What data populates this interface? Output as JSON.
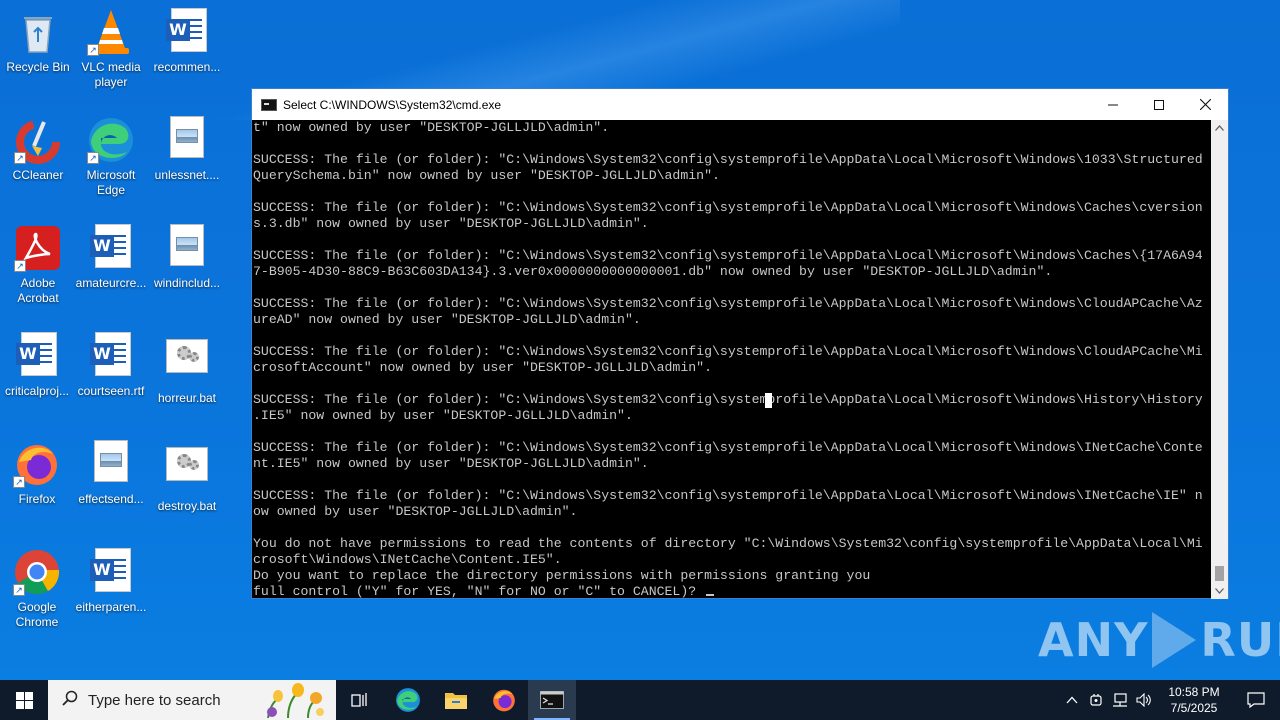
{
  "desktop": {
    "icons": [
      {
        "label": "Recycle Bin",
        "icon": "recycle-bin-icon"
      },
      {
        "label": "VLC media player",
        "icon": "vlc-icon"
      },
      {
        "label": "recommen...",
        "icon": "word-document-icon"
      },
      {
        "label": "CCleaner",
        "icon": "ccleaner-icon"
      },
      {
        "label": "Microsoft Edge",
        "icon": "edge-icon"
      },
      {
        "label": "unlessnet....",
        "icon": "image-file-icon"
      },
      {
        "label": "Adobe Acrobat",
        "icon": "acrobat-icon"
      },
      {
        "label": "amateurcre...",
        "icon": "word-document-icon"
      },
      {
        "label": "windinclud...",
        "icon": "image-file-icon"
      },
      {
        "label": "criticalproj...",
        "icon": "word-document-icon"
      },
      {
        "label": "courtseen.rtf",
        "icon": "word-document-icon"
      },
      {
        "label": "horreur.bat",
        "icon": "batch-file-icon"
      },
      {
        "label": "Firefox",
        "icon": "firefox-icon"
      },
      {
        "label": "effectsend...",
        "icon": "image-file-icon"
      },
      {
        "label": "destroy.bat",
        "icon": "batch-file-icon"
      },
      {
        "label": "Google Chrome",
        "icon": "chrome-icon"
      },
      {
        "label": "eitherparen...",
        "icon": "word-document-icon"
      }
    ]
  },
  "cmd": {
    "title": "Select C:\\WINDOWS\\System32\\cmd.exe",
    "lines": [
      "t\" now owned by user \"DESKTOP-JGLLJLD\\admin\".",
      "",
      "SUCCESS: The file (or folder): \"C:\\Windows\\System32\\config\\systemprofile\\AppData\\Local\\Microsoft\\Windows\\1033\\Structured",
      "QuerySchema.bin\" now owned by user \"DESKTOP-JGLLJLD\\admin\".",
      "",
      "SUCCESS: The file (or folder): \"C:\\Windows\\System32\\config\\systemprofile\\AppData\\Local\\Microsoft\\Windows\\Caches\\cversion",
      "s.3.db\" now owned by user \"DESKTOP-JGLLJLD\\admin\".",
      "",
      "SUCCESS: The file (or folder): \"C:\\Windows\\System32\\config\\systemprofile\\AppData\\Local\\Microsoft\\Windows\\Caches\\{17A6A94",
      "7-B905-4D30-88C9-B63C603DA134}.3.ver0x0000000000000001.db\" now owned by user \"DESKTOP-JGLLJLD\\admin\".",
      "",
      "SUCCESS: The file (or folder): \"C:\\Windows\\System32\\config\\systemprofile\\AppData\\Local\\Microsoft\\Windows\\CloudAPCache\\Az",
      "ureAD\" now owned by user \"DESKTOP-JGLLJLD\\admin\".",
      "",
      "SUCCESS: The file (or folder): \"C:\\Windows\\System32\\config\\systemprofile\\AppData\\Local\\Microsoft\\Windows\\CloudAPCache\\Mi",
      "crosoftAccount\" now owned by user \"DESKTOP-JGLLJLD\\admin\".",
      "",
      "SUCCESS: The file (or folder): \"C:\\Windows\\System32\\config\\systemprofile\\AppData\\Local\\Microsoft\\Windows\\History\\History",
      ".IE5\" now owned by user \"DESKTOP-JGLLJLD\\admin\".",
      "",
      "SUCCESS: The file (or folder): \"C:\\Windows\\System32\\config\\systemprofile\\AppData\\Local\\Microsoft\\Windows\\INetCache\\Conte",
      "nt.IE5\" now owned by user \"DESKTOP-JGLLJLD\\admin\".",
      "",
      "SUCCESS: The file (or folder): \"C:\\Windows\\System32\\config\\systemprofile\\AppData\\Local\\Microsoft\\Windows\\INetCache\\IE\" n",
      "ow owned by user \"DESKTOP-JGLLJLD\\admin\".",
      "",
      "You do not have permissions to read the contents of directory \"C:\\Windows\\System32\\config\\systemprofile\\AppData\\Local\\Mi",
      "crosoft\\Windows\\INetCache\\Content.IE5\".",
      "Do you want to replace the directory permissions with permissions granting you",
      "full control (\"Y\" for YES, \"N\" for NO or \"C\" to CANCEL)?"
    ]
  },
  "watermark": {
    "left": "ANY",
    "right": "RUN"
  },
  "taskbar": {
    "search_placeholder": "Type here to search",
    "time": "10:58 PM",
    "date": "7/5/2025"
  }
}
